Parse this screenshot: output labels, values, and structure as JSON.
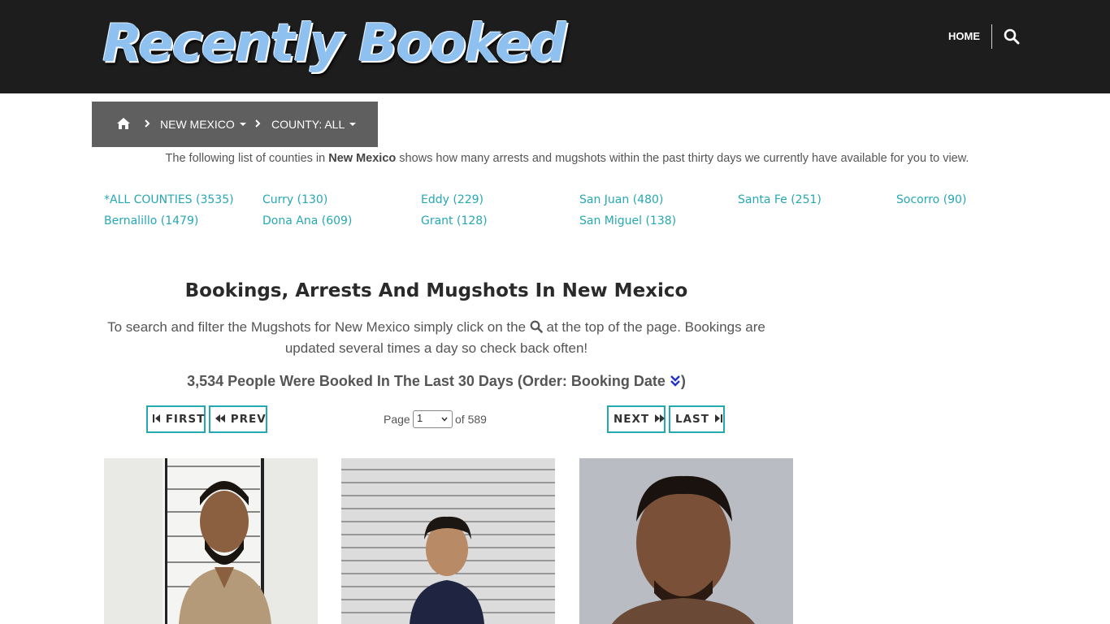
{
  "header": {
    "logo_text": "Recently Booked",
    "nav_home": "HOME",
    "search_icon": "search-icon",
    "bg_color": "#1d1d1d"
  },
  "breadcrumb": {
    "home_icon": "home-icon",
    "state": "NEW MEXICO",
    "county": "COUNTY: ALL"
  },
  "intro": {
    "before": "The following list of counties in ",
    "state": "New Mexico",
    "after": " shows how many arrests and mugshots within the past thirty days we currently have available for you to view."
  },
  "counties": [
    "*ALL COUNTIES (3535)",
    "Curry (130)",
    "Eddy (229)",
    "San Juan (480)",
    "Santa Fe (251)",
    "Socorro (90)",
    "Bernalillo (1479)",
    "Dona Ana (609)",
    "Grant (128)",
    "San Miguel (138)"
  ],
  "main": {
    "heading": "Bookings, Arrests And Mugshots In New Mexico",
    "info_before": "To search and filter the Mugshots for New Mexico simply click on the ",
    "info_after": " at the top of the page. Bookings are updated several times a day so check back often!",
    "booked_text": "3,534 People Were Booked In The Last 30 Days (Order: Booking Date ",
    "booked_close": ")"
  },
  "pager": {
    "first": "FIRST",
    "prev": "PREV",
    "next": "NEXT",
    "last": "LAST",
    "page_label": "Page",
    "page_value": "1",
    "of_label": "of 589"
  },
  "colors": {
    "accent": "#26a8b2",
    "breadcrumb_bg": "#5f5f5f"
  }
}
